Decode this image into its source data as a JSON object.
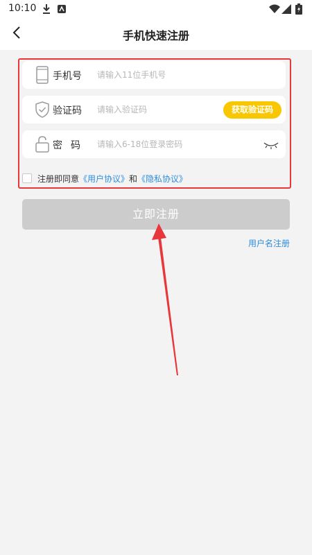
{
  "status_bar": {
    "time": "10:10",
    "left_icons": [
      "download-icon",
      "app-icon"
    ],
    "right_icons": [
      "wifi-icon",
      "signal-icon",
      "battery-icon"
    ]
  },
  "header": {
    "title": "手机快速注册",
    "back_icon": "chevron-left-icon"
  },
  "form": {
    "phone": {
      "label": "手机号",
      "placeholder": "请输入11位手机号",
      "value": "",
      "icon": "phone-icon"
    },
    "code": {
      "label": "验证码",
      "placeholder": "请输入验证码",
      "value": "",
      "icon": "shield-check-icon",
      "button_label": "获取验证码"
    },
    "password": {
      "label": "密码",
      "placeholder": "请输入6-18位登录密码",
      "value": "",
      "icon": "lock-icon",
      "toggle_icon": "eye-closed-icon"
    }
  },
  "agreement": {
    "prefix": "注册即同意",
    "user_agreement": "《用户协议》",
    "conjunction": "和",
    "privacy_agreement": "《隐私协议》",
    "checked": false
  },
  "register_button": {
    "label": "立即注册",
    "enabled": false
  },
  "username_register_link": "用户名注册",
  "colors": {
    "accent_yellow": "#f9c700",
    "link_blue": "#2f8dde",
    "highlight_red": "#e8373a",
    "disabled_button": "#cccccc",
    "background": "#f3f3f3"
  }
}
